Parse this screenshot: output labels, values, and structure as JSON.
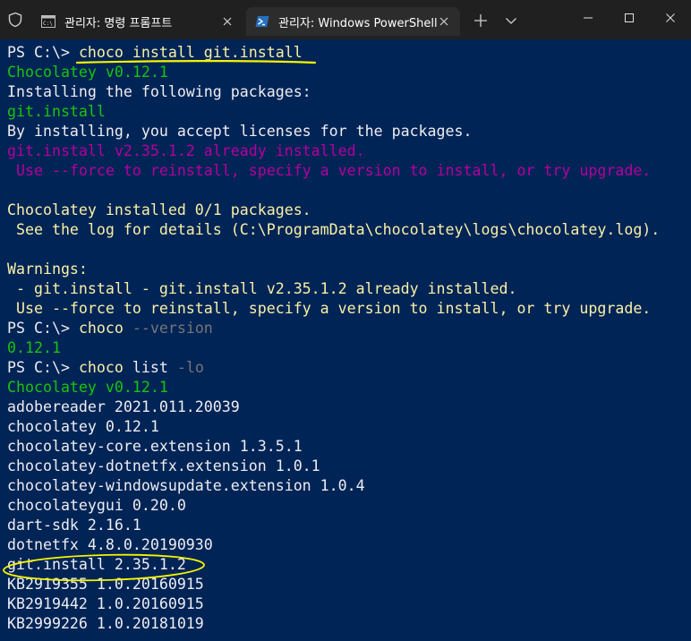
{
  "titlebar": {
    "tabs": [
      {
        "label": "관리자: 명령 프롬프트",
        "icon": "command-prompt-icon",
        "active": false
      },
      {
        "label": "관리자: Windows PowerShell",
        "icon": "powershell-icon",
        "active": true
      }
    ]
  },
  "colors": {
    "terminal_bg": "#012456",
    "default_text": "#eeedf0",
    "green": "#16c60c",
    "yellow": "#f9f1a5",
    "magenta": "#b4009e",
    "gray": "#767676",
    "annotation": "#f5f500"
  },
  "terminal": {
    "lines": [
      [
        {
          "t": "PS C:\\> ",
          "c": "default"
        },
        {
          "t": "choco install git.install",
          "c": "yellow"
        }
      ],
      [
        {
          "t": "Chocolatey v0.12.1",
          "c": "green"
        }
      ],
      [
        {
          "t": "Installing the following packages:",
          "c": "default"
        }
      ],
      [
        {
          "t": "git.install",
          "c": "green"
        }
      ],
      [
        {
          "t": "By installing, you accept licenses for the packages.",
          "c": "default"
        }
      ],
      [
        {
          "t": "git.install v2.35.1.2 already installed.",
          "c": "magenta"
        }
      ],
      [
        {
          "t": " Use --force to reinstall, specify a version to install, or try upgrade.",
          "c": "magenta"
        }
      ],
      [
        {
          "t": "",
          "c": "default"
        }
      ],
      [
        {
          "t": "Chocolatey installed 0/1 packages.",
          "c": "yellow"
        }
      ],
      [
        {
          "t": " See the log for details (C:\\ProgramData\\chocolatey\\logs\\chocolatey.log).",
          "c": "yellow"
        }
      ],
      [
        {
          "t": "",
          "c": "default"
        }
      ],
      [
        {
          "t": "Warnings:",
          "c": "yellow"
        }
      ],
      [
        {
          "t": " - git.install - git.install v2.35.1.2 already installed.",
          "c": "yellow"
        }
      ],
      [
        {
          "t": " Use --force to reinstall, specify a version to install, or try upgrade.",
          "c": "yellow"
        }
      ],
      [
        {
          "t": "PS C:\\> ",
          "c": "default"
        },
        {
          "t": "choco",
          "c": "yellow"
        },
        {
          "t": " --version",
          "c": "gray"
        }
      ],
      [
        {
          "t": "0.12.1",
          "c": "green"
        }
      ],
      [
        {
          "t": "PS C:\\> ",
          "c": "default"
        },
        {
          "t": "choco",
          "c": "yellow"
        },
        {
          "t": " list",
          "c": "default"
        },
        {
          "t": " -lo",
          "c": "gray"
        }
      ],
      [
        {
          "t": "Chocolatey v0.12.1",
          "c": "green"
        }
      ],
      [
        {
          "t": "adobereader 2021.011.20039",
          "c": "default"
        }
      ],
      [
        {
          "t": "chocolatey 0.12.1",
          "c": "default"
        }
      ],
      [
        {
          "t": "chocolatey-core.extension 1.3.5.1",
          "c": "default"
        }
      ],
      [
        {
          "t": "chocolatey-dotnetfx.extension 1.0.1",
          "c": "default"
        }
      ],
      [
        {
          "t": "chocolatey-windowsupdate.extension 1.0.4",
          "c": "default"
        }
      ],
      [
        {
          "t": "chocolateygui 0.20.0",
          "c": "default"
        }
      ],
      [
        {
          "t": "dart-sdk 2.16.1",
          "c": "default"
        }
      ],
      [
        {
          "t": "dotnetfx 4.8.0.20190930",
          "c": "default"
        }
      ],
      [
        {
          "t": "git.install 2.35.1.2",
          "c": "default"
        }
      ],
      [
        {
          "t": "KB2919355 1.0.20160915",
          "c": "default"
        }
      ],
      [
        {
          "t": "KB2919442 1.0.20160915",
          "c": "default"
        }
      ],
      [
        {
          "t": "KB2999226 1.0.20181019",
          "c": "default"
        }
      ]
    ]
  }
}
